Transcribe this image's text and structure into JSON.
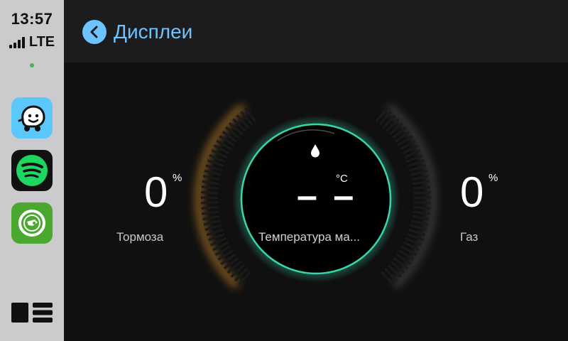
{
  "status_bar": {
    "time": "13:57",
    "network": "LTE",
    "signal_level": 4
  },
  "dock": {
    "apps": [
      {
        "name": "waze-icon"
      },
      {
        "name": "spotify-icon"
      },
      {
        "name": "skoda-icon"
      }
    ]
  },
  "header": {
    "title": "Дисплеи"
  },
  "gauges": {
    "brake": {
      "value": "0",
      "unit": "%",
      "label": "Тормоза"
    },
    "throttle": {
      "value": "0",
      "unit": "%",
      "label": "Газ"
    },
    "oil_temp": {
      "value": "– –",
      "unit": "°C",
      "label": "Температура ма..."
    }
  },
  "colors": {
    "accent": "#6cc3ff",
    "brake_glow": "#f0a030",
    "center_ring": "#36d1a8"
  }
}
